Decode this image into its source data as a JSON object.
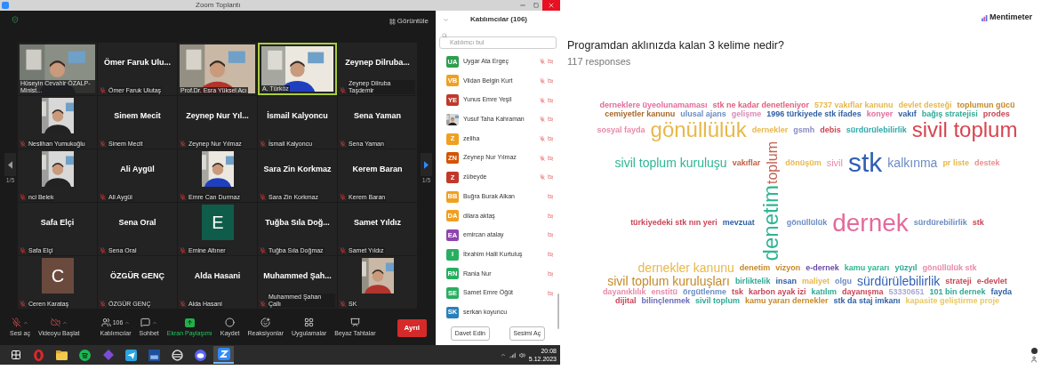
{
  "zoom_window": {
    "title": "Zoom Toplantı",
    "view_button": "Görüntüle",
    "page_left": "1/5",
    "page_right": "1/5",
    "tiles": [
      {
        "kind": "video",
        "label": "Hüseyin Cevahir ÖZALP-Minist...",
        "muted": false,
        "speaking": false
      },
      {
        "kind": "name",
        "name": "Ömer Faruk Ulu...",
        "label": "Ömer Faruk Ulutaş",
        "muted": true,
        "speaking": false
      },
      {
        "kind": "video",
        "label": "Prof.Dr. Esra Yüksel Acı",
        "muted": false,
        "speaking": false
      },
      {
        "kind": "video",
        "label": "A. Türköz",
        "muted": false,
        "speaking": true
      },
      {
        "kind": "name",
        "name": "Zeynep Dilruba...",
        "label": "Zeynep Dilruba Taşdemir",
        "muted": true,
        "speaking": false
      },
      {
        "label": "Neslihan Yumukoğlu",
        "muted": true,
        "speaking": false
      },
      {
        "kind": "name",
        "name": "Sinem Mecit",
        "label": "Sinem Mecit",
        "muted": true,
        "speaking": false
      },
      {
        "kind": "name",
        "name": "Zeynep Nur Yıl...",
        "label": "Zeynep Nur Yılmaz",
        "muted": true,
        "speaking": false
      },
      {
        "kind": "name",
        "name": "İsmail Kalyoncu",
        "label": "İsmail Kalyoncu",
        "muted": true,
        "speaking": false
      },
      {
        "kind": "name",
        "name": "Sena Yaman",
        "label": "Sena Yaman",
        "muted": true,
        "speaking": false
      },
      {
        "label": "nci Belek",
        "muted": true,
        "speaking": false
      },
      {
        "kind": "name",
        "name": "Ali Aygül",
        "label": "Ali Aygül",
        "muted": true,
        "speaking": false
      },
      {
        "label": "Emre Can Durmaz",
        "muted": true,
        "speaking": false
      },
      {
        "kind": "name",
        "name": "Sara Zin Korkmaz",
        "label": "Sara Zin Korkmaz",
        "muted": true,
        "speaking": false
      },
      {
        "kind": "name",
        "name": "Kerem Baran",
        "label": "Kerem Baran",
        "muted": true,
        "speaking": false
      },
      {
        "kind": "name",
        "name": "Safa Elçi",
        "label": "Safa Elçi",
        "muted": true,
        "speaking": false
      },
      {
        "kind": "name",
        "name": "Sena Oral",
        "label": "Sena Oral",
        "muted": true,
        "speaking": false
      },
      {
        "kind": "avatar",
        "letter": "E",
        "color": "#0f5c4a",
        "label": "Emine Altıner",
        "muted": true,
        "speaking": false
      },
      {
        "kind": "name",
        "name": "Tuğba Sıla Doğ...",
        "label": "Tuğba Sıla Doğmaz",
        "muted": true,
        "speaking": false
      },
      {
        "kind": "name",
        "name": "Samet Yıldız",
        "label": "Samet Yıldız",
        "muted": true,
        "speaking": false
      },
      {
        "kind": "avatar",
        "letter": "C",
        "color": "#6b4a3e",
        "label": "Ceren Karataş",
        "muted": true,
        "speaking": false
      },
      {
        "kind": "name",
        "name": "ÖZGÜR GENÇ",
        "label": "ÖZGÜR GENÇ",
        "muted": true,
        "speaking": false
      },
      {
        "kind": "name",
        "name": "Alda Hasani",
        "label": "Alda Hasani",
        "muted": true,
        "speaking": false
      },
      {
        "kind": "name",
        "name": "Muhammed Şah...",
        "label": "Muhammed Şahan Çallı",
        "muted": true,
        "speaking": false
      },
      {
        "label": "SK",
        "muted": true,
        "speaking": false
      }
    ],
    "toolbar": [
      {
        "label": "Sesi aç",
        "highlighted": false
      },
      {
        "label": "Videoyu Başlat",
        "highlighted": false
      },
      {
        "label": "Katılımcılar",
        "count": "106",
        "highlighted": false
      },
      {
        "label": "Sohbet",
        "highlighted": false
      },
      {
        "label": "Ekran Paylaşımı",
        "highlighted": true
      },
      {
        "label": "Kaydet",
        "highlighted": false
      },
      {
        "label": "Reaksiyonlar",
        "highlighted": false
      },
      {
        "label": "Uygulamalar",
        "highlighted": false
      },
      {
        "label": "Beyaz Tahtalar",
        "highlighted": false
      }
    ],
    "leave_button": "Ayrıl",
    "participants_panel": {
      "title": "Katılımcılar (106)",
      "search": {
        "placeholder": "Katılımcı bul"
      },
      "participants": [
        {
          "kind": "initials",
          "initials": "UA",
          "color": "#2e9e4f",
          "name": "Uygar Ata Ergeç",
          "muted": true,
          "video_off": true
        },
        {
          "kind": "initials",
          "initials": "VB",
          "color": "#f0a020",
          "name": "Vildan Belgin Kurt",
          "muted": true,
          "video_off": true
        },
        {
          "kind": "initials",
          "initials": "YE",
          "color": "#c0392b",
          "name": "Yunus Emre Yeşil",
          "muted": true,
          "video_off": true
        },
        {
          "name": "Yusuf Taha Kahraman",
          "muted": true,
          "video_off": true
        },
        {
          "kind": "initials",
          "initials": "Z",
          "color": "#f0a020",
          "name": "zeliha",
          "muted": true,
          "video_off": true
        },
        {
          "kind": "initials",
          "initials": "ZN",
          "color": "#d35400",
          "name": "Zeynep Nur Yılmaz",
          "muted": true,
          "video_off": true
        },
        {
          "kind": "initials",
          "initials": "Z",
          "color": "#c0392b",
          "name": "zübeyde",
          "muted": true,
          "video_off": true
        },
        {
          "kind": "initials",
          "initials": "BB",
          "color": "#f0a020",
          "name": "Buğra Burak Alkan",
          "muted": false,
          "video_off": true
        },
        {
          "kind": "initials",
          "initials": "DA",
          "color": "#f0a020",
          "name": "dilara aktaş",
          "muted": false,
          "video_off": true
        },
        {
          "kind": "initials",
          "initials": "EA",
          "color": "#8e44ad",
          "name": "emircan atalay",
          "muted": false,
          "video_off": true
        },
        {
          "kind": "initials",
          "initials": "I",
          "color": "#27ae60",
          "name": "İbrahim Halil Kurtuluş",
          "muted": false,
          "video_off": true
        },
        {
          "kind": "initials",
          "initials": "RN",
          "color": "#27ae60",
          "name": "Rania Nur",
          "muted": false,
          "video_off": true
        },
        {
          "kind": "initials",
          "initials": "SE",
          "color": "#27ae60",
          "name": "Samet Emre Öğüt",
          "muted": false,
          "video_off": true
        },
        {
          "kind": "initials",
          "initials": "SK",
          "color": "#2980b9",
          "name": "serkan koyuncu",
          "muted": false,
          "video_off": false
        }
      ],
      "buttons": [
        "Davet Edin",
        "Sesimi Aç"
      ]
    },
    "taskbar": {
      "apps": [
        {
          "selected": false
        },
        {
          "selected": false
        },
        {
          "selected": false
        },
        {
          "selected": false
        },
        {
          "selected": false
        },
        {
          "selected": false
        },
        {
          "selected": false
        },
        {
          "selected": false
        },
        {
          "selected": false
        },
        {
          "selected": true
        }
      ],
      "time": "20:08",
      "date": "5.12.2023"
    }
  },
  "mentimeter": {
    "brand": "Mentimeter",
    "question": "Programdan aklınızda kalan 3 kelime nedir?",
    "responses": "117 responses",
    "words": [
      {
        "text": "derneklere üyeolunamaması",
        "color": "#e46b9c"
      },
      {
        "text": "stk ne kadar denetleniyor",
        "color": "#e0607f"
      },
      {
        "text": "5737 vakıflar kanunu",
        "color": "#e8b84a"
      },
      {
        "text": "devlet desteği",
        "color": "#e8b84a"
      },
      {
        "text": "toplumun gücü",
        "color": "#c58a2a"
      },
      {
        "text": "cemiyetler kanunu",
        "color": "#a8682a"
      },
      {
        "text": "ulusal ajans",
        "color": "#6a8cc4"
      },
      {
        "text": "gelişme",
        "color": "#d98bb6"
      },
      {
        "text": "1996 türkiyede stk ifades",
        "color": "#2f5fa5"
      },
      {
        "text": "konyer",
        "color": "#e46b9c"
      },
      {
        "text": "vakıf",
        "color": "#2f5fa5"
      },
      {
        "text": "bağış stratejisi",
        "color": "#2fa894"
      },
      {
        "text": "prodes",
        "color": "#c94455"
      },
      {
        "text": "sosyal fayda",
        "color": "#e88aa8"
      },
      {
        "text": "gönüllülük",
        "color": "#e8b84a"
      },
      {
        "text": "dernekler",
        "color": "#e8b84a"
      },
      {
        "text": "gsmh",
        "color": "#8a8ac4"
      },
      {
        "text": "debis",
        "color": "#c94455"
      },
      {
        "text": "sürdürülebilirlik",
        "color": "#2fa8a8"
      },
      {
        "text": "sivil toplum",
        "color": "#d64550"
      },
      {
        "text": "sivil toplum kuruluşu",
        "color": "#2fb594"
      },
      {
        "text": "vakıflar",
        "color": "#c06040"
      },
      {
        "text": "toplum",
        "color": "#c06050"
      },
      {
        "text": "dönüşüm",
        "color": "#e8b84a"
      },
      {
        "text": "sivil",
        "color": "#e88aa8"
      },
      {
        "text": "stk",
        "color": "#2f5fb5"
      },
      {
        "text": "kalkınma",
        "color": "#6a8cc4"
      },
      {
        "text": "pr liste",
        "color": "#e8b84a"
      },
      {
        "text": "destek",
        "color": "#e89090"
      },
      {
        "text": "türkiyedeki stk nın yeri",
        "color": "#c94455"
      },
      {
        "text": "mevzuat",
        "color": "#2f5fa5"
      },
      {
        "text": "denetim",
        "color": "#2fb594"
      },
      {
        "text": "gönüllülük",
        "color": "#6a8cc4"
      },
      {
        "text": "dernek",
        "color": "#e46b9c"
      },
      {
        "text": "sürdürebilirlik",
        "color": "#6a8cc4"
      },
      {
        "text": "stk",
        "color": "#c94455"
      },
      {
        "text": "dernekler kanunu",
        "color": "#e8b84a"
      },
      {
        "text": "denetim",
        "color": "#c58a2a"
      },
      {
        "text": "vizyon",
        "color": "#c58a2a"
      },
      {
        "text": "e-dernek",
        "color": "#6a4aa8"
      },
      {
        "text": "kamu yararı",
        "color": "#2fb594"
      },
      {
        "text": "yüzyıl",
        "color": "#2fa894"
      },
      {
        "text": "gönüllülük stk",
        "color": "#e88aa8"
      },
      {
        "text": "sivil toplum kuruluşları",
        "color": "#c58a2a"
      },
      {
        "text": "birliktelik",
        "color": "#2fa894"
      },
      {
        "text": "insan",
        "color": "#2f5fa5"
      },
      {
        "text": "maliyet",
        "color": "#e8b84a"
      },
      {
        "text": "olgu",
        "color": "#6a8cc4"
      },
      {
        "text": "sürdürülebilirlik",
        "color": "#2f5fb5"
      },
      {
        "text": "strateji",
        "color": "#c94455"
      },
      {
        "text": "e-devlet",
        "color": "#c94455"
      },
      {
        "text": "dayanıklılık",
        "color": "#e88aa8"
      },
      {
        "text": "enstitü",
        "color": "#e88aa8"
      },
      {
        "text": "örgütlenme",
        "color": "#6a8cc4"
      },
      {
        "text": "tsk",
        "color": "#c94455"
      },
      {
        "text": "karbon ayak izi",
        "color": "#c94455"
      },
      {
        "text": "katılım",
        "color": "#2fa894"
      },
      {
        "text": "dayanışma",
        "color": "#c94455"
      },
      {
        "text": "53330651",
        "color": "#a8a8d8"
      },
      {
        "text": "101 bin dernek",
        "color": "#2fa894"
      },
      {
        "text": "fayda",
        "color": "#2f5fa5"
      },
      {
        "text": "dijital",
        "color": "#c94455"
      },
      {
        "text": "bilinçlenmek",
        "color": "#6a6ab8"
      },
      {
        "text": "sivil toplum",
        "color": "#2fa894"
      },
      {
        "text": "kamu yararı dernekler",
        "color": "#c58a2a"
      },
      {
        "text": "stk da staj imkanı",
        "color": "#2f5fa5"
      },
      {
        "text": "kapasite geliştirme proje",
        "color": "#e8c860"
      }
    ]
  }
}
